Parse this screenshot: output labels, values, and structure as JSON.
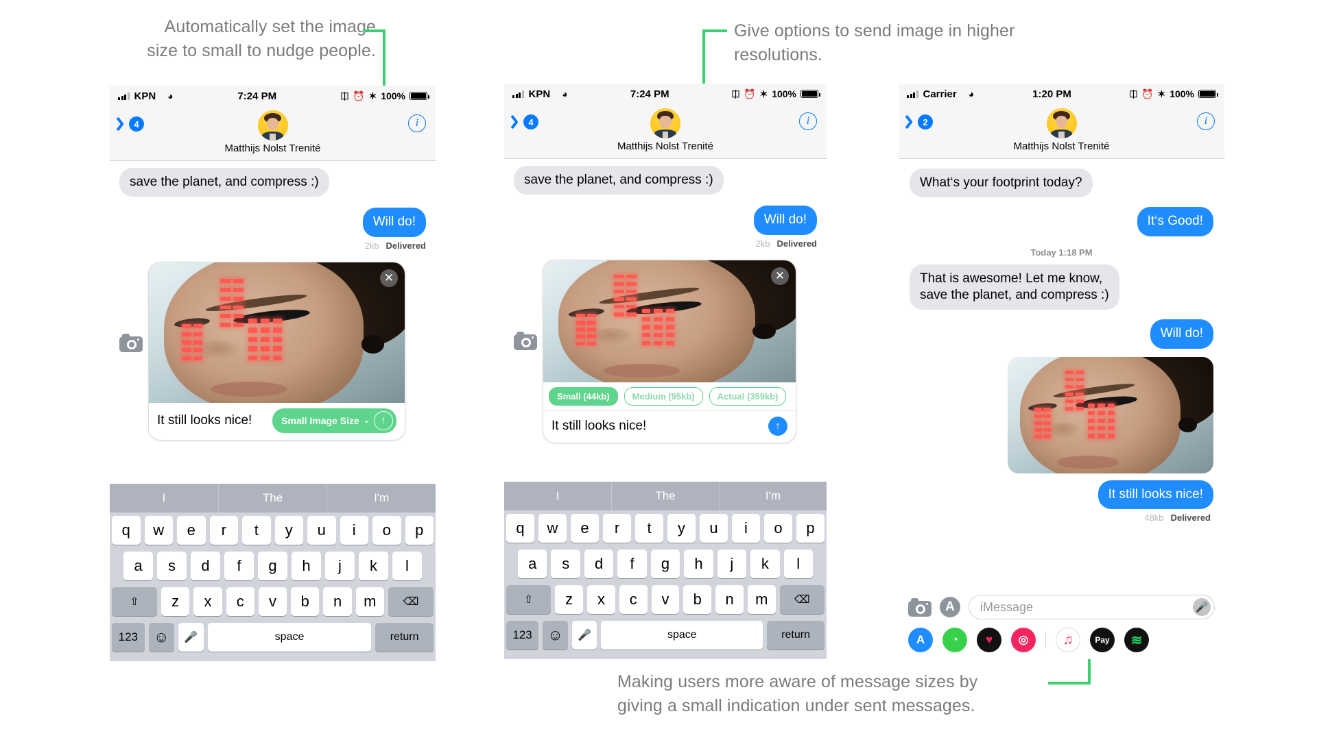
{
  "annotations": {
    "top_left": "Automatically set the image\nsize to small to nudge people.",
    "top_right": "Give options to send image in higher\nresolutions.",
    "bottom": "Making users more aware of message sizes by\ngiving a small indication under sent messages.",
    "accent_color": "#3ad06f"
  },
  "phone1": {
    "status": {
      "carrier": "KPN",
      "time": "7:24 PM",
      "battery": "100%"
    },
    "nav": {
      "back_count": "4",
      "contact": "Matthijs Nolst Trenité",
      "info": "i"
    },
    "messages": [
      {
        "side": "in",
        "text": "save the planet, and compress :)"
      },
      {
        "side": "out",
        "text": "Will do!",
        "size": "2kb",
        "status": "Delivered"
      }
    ],
    "composer": {
      "text": "It still looks nice!",
      "size_pill": "Small Image Size",
      "caret": "⌄",
      "send": "↑",
      "close": "✕"
    },
    "keyboard": {
      "predictions": [
        "I",
        "The",
        "I'm"
      ],
      "row1": [
        "q",
        "w",
        "e",
        "r",
        "t",
        "y",
        "u",
        "i",
        "o",
        "p"
      ],
      "row2": [
        "a",
        "s",
        "d",
        "f",
        "g",
        "h",
        "j",
        "k",
        "l"
      ],
      "row3": [
        "z",
        "x",
        "c",
        "v",
        "b",
        "n",
        "m"
      ],
      "shift": "⇧",
      "backspace": "⌫",
      "numbers": "123",
      "emoji": "☺",
      "dictate": "🎤",
      "space": "space",
      "return": "return"
    }
  },
  "phone2": {
    "status": {
      "carrier": "KPN",
      "time": "7:24 PM",
      "battery": "100%"
    },
    "nav": {
      "back_count": "4",
      "contact": "Matthijs Nolst Trenité",
      "info": "i"
    },
    "messages": [
      {
        "side": "in",
        "text": "save the planet, and compress :)"
      },
      {
        "side": "out",
        "text": "Will do!",
        "size": "2kb",
        "status": "Delivered"
      }
    ],
    "composer": {
      "text": "It still looks nice!",
      "send": "↑",
      "close": "✕",
      "size_options": [
        {
          "label": "Small (44kb)",
          "selected": true
        },
        {
          "label": "Medium (95kb)",
          "selected": false
        },
        {
          "label": "Actual (359kb)",
          "selected": false
        }
      ]
    },
    "keyboard": {
      "predictions": [
        "I",
        "The",
        "I'm"
      ],
      "row1": [
        "q",
        "w",
        "e",
        "r",
        "t",
        "y",
        "u",
        "i",
        "o",
        "p"
      ],
      "row2": [
        "a",
        "s",
        "d",
        "f",
        "g",
        "h",
        "j",
        "k",
        "l"
      ],
      "row3": [
        "z",
        "x",
        "c",
        "v",
        "b",
        "n",
        "m"
      ],
      "shift": "⇧",
      "backspace": "⌫",
      "numbers": "123",
      "emoji": "☺",
      "dictate": "🎤",
      "space": "space",
      "return": "return"
    }
  },
  "phone3": {
    "status": {
      "carrier": "Carrier",
      "time": "1:20 PM",
      "battery": "100%"
    },
    "nav": {
      "back_count": "2",
      "contact": "Matthijs Nolst Trenité",
      "info": "i"
    },
    "messages": [
      {
        "side": "in",
        "text": "What‘s your footprint today?"
      },
      {
        "side": "out",
        "text": "It‘s Good!"
      }
    ],
    "daystamp": "Today 1:18 PM",
    "messages2": [
      {
        "side": "in",
        "text": "That is awesome! Let me know,\nsave the planet, and compress :)"
      },
      {
        "side": "out",
        "text": "Will do!"
      }
    ],
    "sent_photo_caption": {
      "side": "out",
      "text": "It still looks nice!",
      "size": "48kb",
      "status": "Delivered"
    },
    "composer": {
      "placeholder": "iMessage",
      "camera": "camera-icon",
      "appstore": "A"
    },
    "appdock": [
      {
        "name": "app-store",
        "glyph": "A",
        "bg": "#1f8cff"
      },
      {
        "name": "activity",
        "glyph": "◔",
        "bg": "#38d14b"
      },
      {
        "name": "digital-touch",
        "glyph": "♥",
        "bg": "#111111"
      },
      {
        "name": "images-search",
        "glyph": "◎",
        "bg": "#f4245e"
      },
      {
        "name": "apple-music",
        "glyph": "♫",
        "bg": "#ffffff"
      },
      {
        "name": "apple-pay",
        "glyph": "Pay",
        "bg": "#111111"
      },
      {
        "name": "spotify",
        "glyph": "≋",
        "bg": "#111111"
      }
    ]
  }
}
